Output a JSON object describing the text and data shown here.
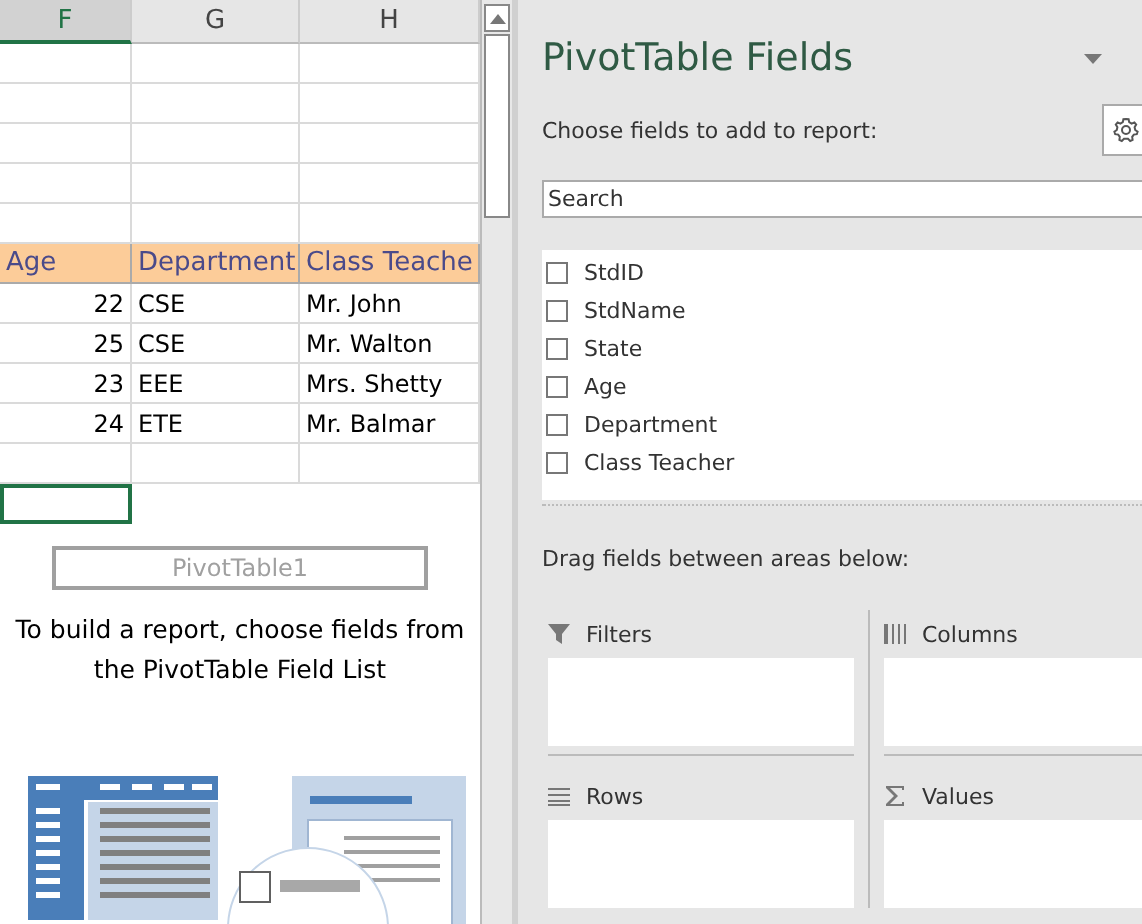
{
  "sheet": {
    "columns": [
      {
        "label": "F",
        "selected": true
      },
      {
        "label": "G",
        "selected": false
      },
      {
        "label": "H",
        "selected": false
      }
    ],
    "table": {
      "header": [
        "Age",
        "Department",
        "Class Teache"
      ],
      "rows": [
        [
          "22",
          "CSE",
          "Mr. John"
        ],
        [
          "25",
          "CSE",
          "Mr. Walton"
        ],
        [
          "23",
          "EEE",
          "Mrs. Shetty"
        ],
        [
          "24",
          "ETE",
          "Mr. Balmar"
        ]
      ]
    },
    "pivot_placeholder": {
      "name": "PivotTable1",
      "instruction": "To build a report, choose fields from the PivotTable Field List"
    }
  },
  "pane": {
    "title": "PivotTable Fields",
    "subtitle": "Choose fields to add to report:",
    "search": {
      "placeholder": "Search"
    },
    "fields": [
      {
        "label": "StdID",
        "checked": false
      },
      {
        "label": "StdName",
        "checked": false
      },
      {
        "label": "State",
        "checked": false
      },
      {
        "label": "Age",
        "checked": false
      },
      {
        "label": "Department",
        "checked": false
      },
      {
        "label": "Class Teacher",
        "checked": false
      }
    ],
    "areas_hint": "Drag fields between areas below:",
    "areas": [
      {
        "kind": "filters",
        "label": "Filters"
      },
      {
        "kind": "columns",
        "label": "Columns"
      },
      {
        "kind": "rows",
        "label": "Rows"
      },
      {
        "kind": "values",
        "label": "Values"
      }
    ]
  }
}
